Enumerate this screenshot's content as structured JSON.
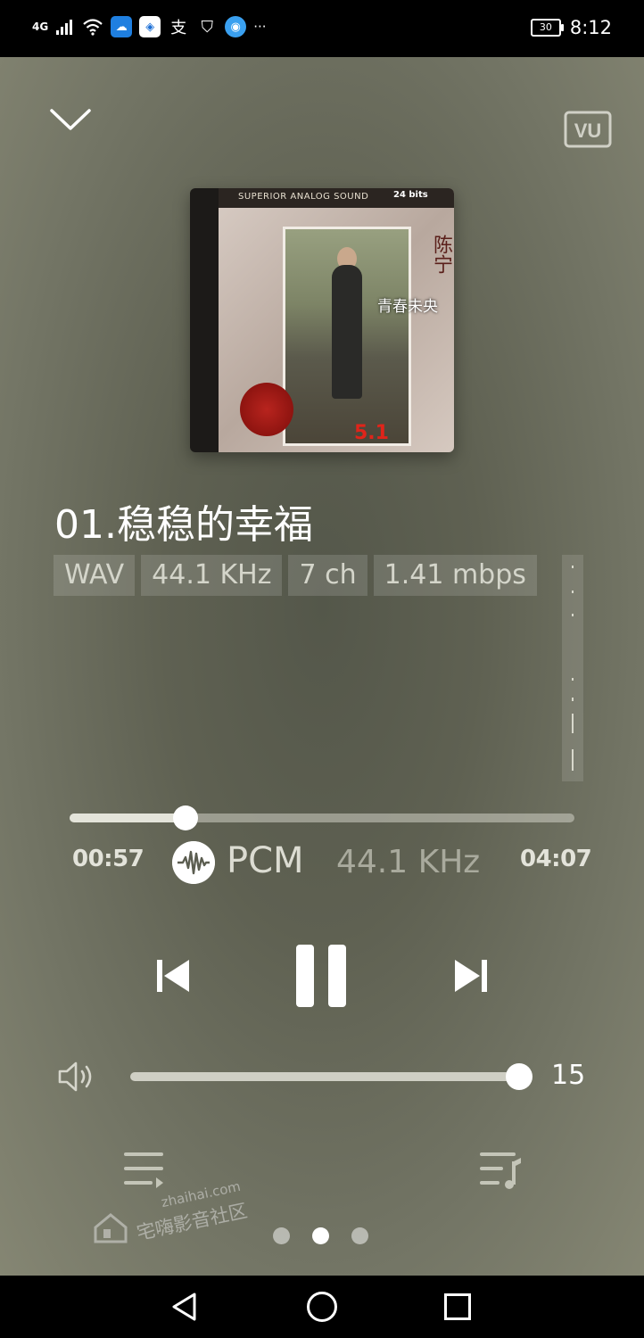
{
  "status_bar": {
    "network": "4G",
    "time": "8:12",
    "battery": "30",
    "more": "···"
  },
  "player": {
    "vu_label": "VU",
    "cover": {
      "top_text": "SUPERIOR ANALOG SOUND",
      "bits": "24 bits",
      "artist": "陈宁",
      "album": "青春未央",
      "badge": "5.1"
    },
    "song_title": "01.稳稳的幸福",
    "tags": [
      "WAV",
      "44.1 KHz",
      "7 ch",
      "1.41 mbps"
    ],
    "progress": {
      "elapsed": "00:57",
      "total": "04:07",
      "fraction": 0.23
    },
    "output": {
      "format": "PCM",
      "rate": "44.1 KHz"
    },
    "volume": {
      "value": "15",
      "fraction": 1.0
    },
    "pages": {
      "count": 3,
      "active": 1
    }
  },
  "watermark": {
    "domain": "zhaihai.com",
    "text": "宅嗨影音社区"
  }
}
